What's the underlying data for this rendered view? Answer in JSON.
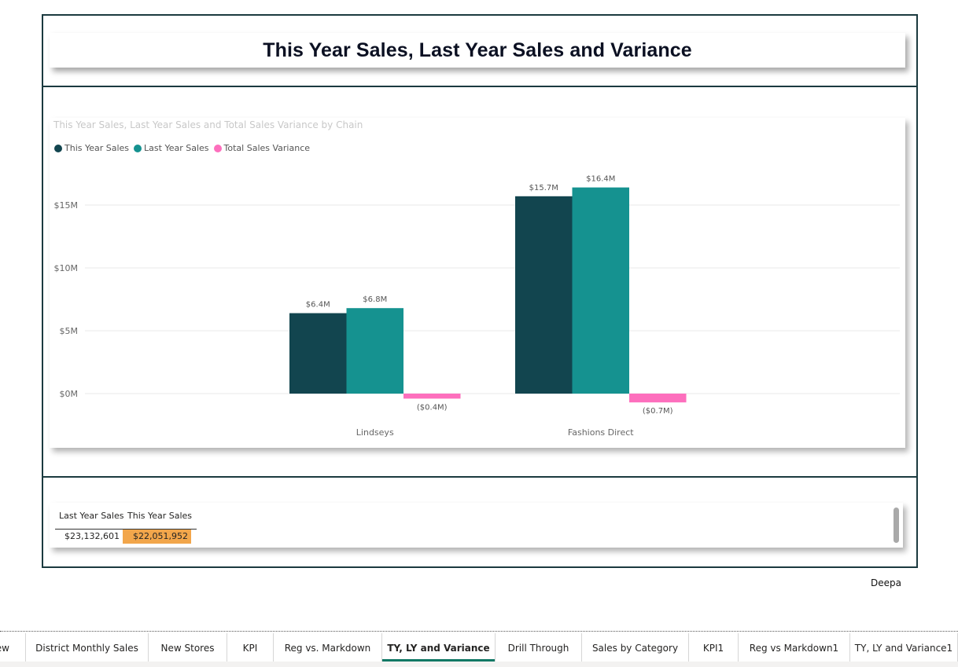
{
  "report": {
    "title": "This Year Sales, Last Year Sales and Variance",
    "user": "Deepa"
  },
  "chart_data": {
    "type": "bar",
    "title": "This Year Sales, Last Year Sales and Total Sales Variance by Chain",
    "categories": [
      "Lindseys",
      "Fashions Direct"
    ],
    "series": [
      {
        "name": "This Year Sales",
        "values": [
          6.4,
          15.7
        ],
        "labels": [
          "$6.4M",
          "$15.7M"
        ],
        "color": "#12454f"
      },
      {
        "name": "Last Year Sales",
        "values": [
          6.8,
          16.4
        ],
        "labels": [
          "$6.8M",
          "$16.4M"
        ],
        "color": "#159290"
      },
      {
        "name": "Total Sales Variance",
        "values": [
          -0.4,
          -0.7
        ],
        "labels": [
          "($0.4M)",
          "($0.7M)"
        ],
        "color": "#fd6fbd"
      }
    ],
    "y_ticks": [
      "$0M",
      "$5M",
      "$10M",
      "$15M"
    ],
    "ylim": [
      -0.7,
      16.4
    ],
    "legend_position": "top-left",
    "grid": true
  },
  "table": {
    "headers": [
      "Last Year Sales",
      "This Year Sales"
    ],
    "values": [
      "$23,132,601",
      "$22,051,952"
    ],
    "highlight_color": "#f2a64b"
  },
  "tabs": {
    "items": [
      "ew",
      "District Monthly Sales",
      "New Stores",
      "KPI",
      "Reg vs. Markdown",
      "TY, LY and Variance",
      "Drill Through",
      "Sales by Category",
      "KPI1",
      "Reg vs Markdown1",
      "TY, LY and Variance1"
    ],
    "active": "TY, LY and Variance",
    "accent": "#117865"
  }
}
